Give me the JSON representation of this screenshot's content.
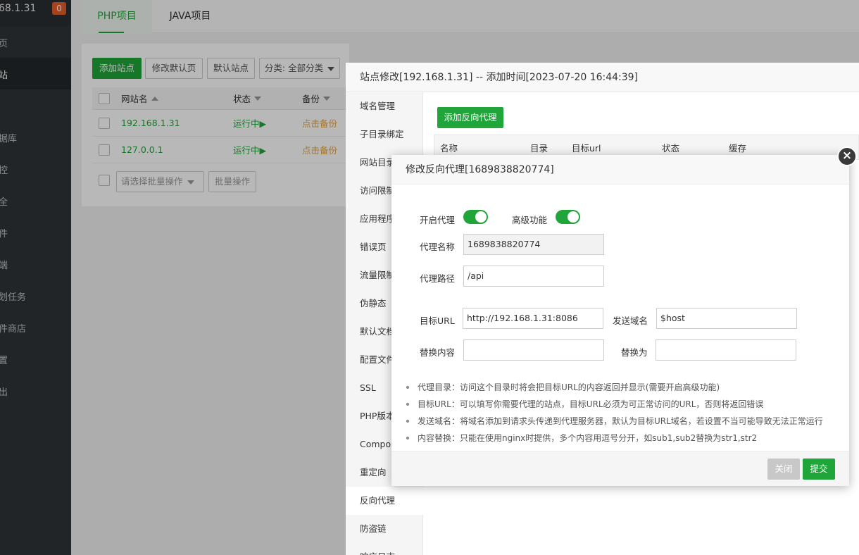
{
  "sidebar": {
    "ip": "68.1.31",
    "badge": "0",
    "items": [
      {
        "label": "页",
        "active": false
      },
      {
        "label": "站",
        "active": true
      },
      {
        "label": "",
        "active": false
      },
      {
        "label": "据库",
        "active": false
      },
      {
        "label": "控",
        "active": false
      },
      {
        "label": "全",
        "active": false
      },
      {
        "label": "件",
        "active": false
      },
      {
        "label": "端",
        "active": false
      },
      {
        "label": "划任务",
        "active": false
      },
      {
        "label": "件商店",
        "active": false
      },
      {
        "label": "置",
        "active": false
      },
      {
        "label": "出",
        "active": false
      }
    ]
  },
  "tabs": [
    "PHP项目",
    "JAVA项目"
  ],
  "toolbar": {
    "add_site": "添加站点",
    "edit_default_page": "修改默认页",
    "default_site": "默认站点",
    "category": "分类: 全部分类"
  },
  "table": {
    "headers": {
      "name": "网站名",
      "status": "状态",
      "note": "备份"
    },
    "rows": [
      {
        "name": "192.168.1.31",
        "status": "运行中▶",
        "note": "点击备份"
      },
      {
        "name": "127.0.0.1",
        "status": "运行中▶",
        "note": "点击备份"
      }
    ],
    "batch_placeholder": "请选择批量操作",
    "batch_button": "批量操作"
  },
  "site_dialog": {
    "title": "站点修改[192.168.1.31] -- 添加时间[2023-07-20 16:44:39]",
    "nav": [
      "域名管理",
      "子目录绑定",
      "网站目录",
      "访问限制",
      "应用程序",
      "错误页",
      "流量限制",
      "伪静态",
      "默认文档",
      "配置文件",
      "SSL",
      "PHP版本",
      "Composer",
      "重定向",
      "反向代理",
      "防盗链",
      "响应日志"
    ],
    "active_nav": "反向代理",
    "add_proxy_button": "添加反向代理",
    "proxy_table_headers": [
      "名称",
      "目录",
      "目标url",
      "状态",
      "缓存"
    ]
  },
  "proxy_dialog": {
    "title": "修改反向代理[1689838820774]",
    "enable_proxy_label": "开启代理",
    "advanced_label": "高级功能",
    "enable_proxy_on": true,
    "advanced_on": true,
    "name_label": "代理名称",
    "name_value": "1689838820774",
    "path_label": "代理路径",
    "path_value": "/api",
    "target_url_label": "目标URL",
    "target_url_value": "http://192.168.1.31:8086",
    "send_domain_label": "发送域名",
    "send_domain_value": "$host",
    "replace_content_label": "替换内容",
    "replace_content_value": "",
    "replace_with_label": "替换为",
    "replace_with_value": "",
    "tips": [
      "代理目录：访问这个目录时将会把目标URL的内容返回并显示(需要开启高级功能)",
      "目标URL：可以填写你需要代理的站点，目标URL必须为可正常访问的URL，否则将返回错误",
      "发送域名：将域名添加到请求头传递到代理服务器，默认为目标URL域名，若设置不当可能导致无法正常运行",
      "内容替换：只能在使用nginx时提供，多个内容用逗号分开，如sub1,sub2替换为str1,str2"
    ],
    "close_button": "关闭",
    "submit_button": "提交"
  },
  "colors": {
    "accent": "#20a53a",
    "sidebar_bg": "#2f3438",
    "badge": "#e55e2c"
  }
}
